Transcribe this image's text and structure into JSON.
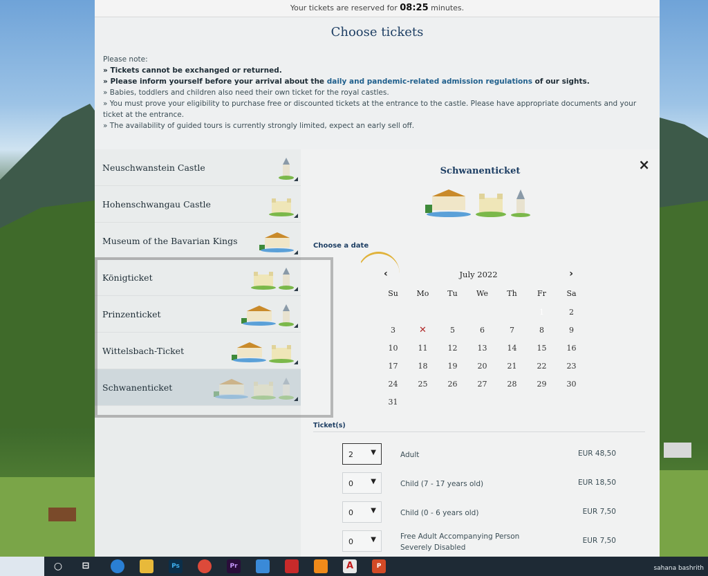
{
  "timer": {
    "prefix": "Your tickets are reserved for",
    "time": "08:25",
    "suffix": "minutes."
  },
  "title": "Choose tickets",
  "notes": {
    "intro": "Please note:",
    "n1": "» Tickets cannot be exchanged or returned.",
    "n2_a": "» Please inform yourself before your arrival about the",
    "n2_link": "daily and pandemic-related admission regulations",
    "n2_b": "of our sights.",
    "n3": "» Babies, toddlers and children also need their own ticket for the royal castles.",
    "n4": "» You must prove your eligibility to purchase free or discounted tickets at the entrance to the castle. Please have appropriate documents and your ticket at the entrance.",
    "n5": "» The availability of guided tours is currently strongly limited, expect an early sell off."
  },
  "menu": [
    {
      "label": "Neuschwanstein Castle"
    },
    {
      "label": "Hohenschwangau Castle"
    },
    {
      "label": "Museum of the Bavarian Kings"
    },
    {
      "label": "Königticket"
    },
    {
      "label": "Prinzenticket"
    },
    {
      "label": "Wittelsbach-Ticket"
    },
    {
      "label": "Schwanenticket"
    }
  ],
  "detail": {
    "close": "×",
    "title": "Schwanenticket",
    "choose_date": "Choose a date",
    "tickets_label": "Ticket(s)"
  },
  "calendar": {
    "prev": "‹",
    "next": "›",
    "month": "July 2022",
    "dow": [
      "Su",
      "Mo",
      "Tu",
      "We",
      "Th",
      "Fr",
      "Sa"
    ],
    "days": [
      "",
      "",
      "",
      "",
      "",
      "1",
      "2",
      "3",
      "✕",
      "5",
      "6",
      "7",
      "8",
      "9",
      "10",
      "11",
      "12",
      "13",
      "14",
      "15",
      "16",
      "17",
      "18",
      "19",
      "20",
      "21",
      "22",
      "23",
      "24",
      "25",
      "26",
      "27",
      "28",
      "29",
      "30",
      "31"
    ],
    "selected": "1"
  },
  "tickets": [
    {
      "qty": "2",
      "name": "Adult",
      "price": "EUR 48,50"
    },
    {
      "qty": "0",
      "name": "Child (7 - 17 years old)",
      "price": "EUR 18,50"
    },
    {
      "qty": "0",
      "name": "Child (0 - 6 years old)",
      "price": "EUR 7,50"
    },
    {
      "qty": "0",
      "name": "Free Adult Accompanying Person Severely Disabled",
      "price": "EUR 7,50"
    }
  ],
  "taskbar": {
    "watermark": "sahana bashrith"
  },
  "colors": {
    "accent": "#1d3e63",
    "panel": "#eef0f1",
    "selected_day": "#5a5a5a"
  }
}
